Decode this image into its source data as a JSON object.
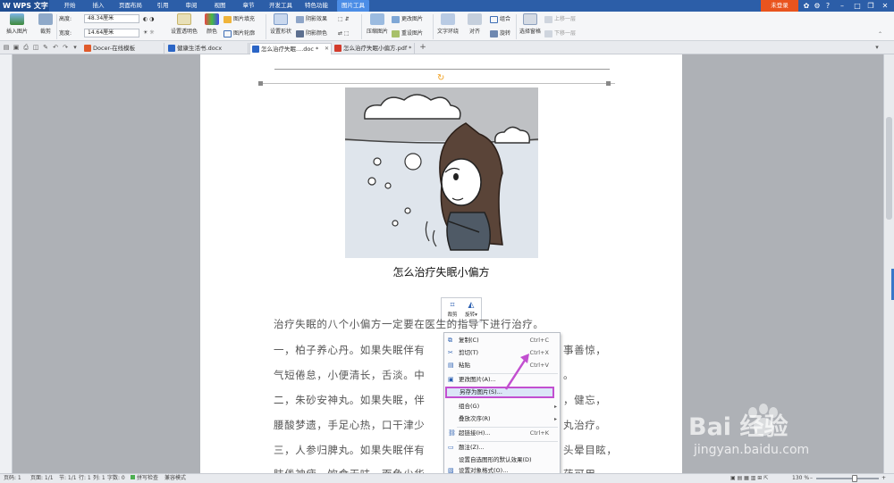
{
  "app": {
    "title": "WPS 文字",
    "login": "未登录"
  },
  "menu": [
    {
      "label": "开始"
    },
    {
      "label": "插入"
    },
    {
      "label": "页面布局"
    },
    {
      "label": "引用"
    },
    {
      "label": "审阅"
    },
    {
      "label": "视图"
    },
    {
      "label": "章节"
    },
    {
      "label": "开发工具"
    },
    {
      "label": "特色功能"
    },
    {
      "label": "图片工具",
      "active": true
    }
  ],
  "ribbon": {
    "insert_picture": "插入图片",
    "crop": "裁剪",
    "height_label": "高度:",
    "height_value": "48.34厘米",
    "width_label": "宽度:",
    "width_value": "14.64厘米",
    "set_transparent": "设置透明色",
    "color": "颜色",
    "picture_fill": "图片填充",
    "picture_outline": "图片轮廓",
    "set_shape": "设置形状",
    "shadow_effect": "阴影效果",
    "shadow_color": "阴影颜色",
    "compress": "压缩图片",
    "change_picture": "更改图片",
    "reset_picture": "重设图片",
    "text_wrap": "文字环绕",
    "align": "对齐",
    "group": "组合",
    "rotate": "旋转",
    "selection_pane": "选择窗格",
    "bring_forward": "上移一层",
    "send_backward": "下移一层"
  },
  "tabs": [
    {
      "label": "Docer-在线模板",
      "icon": "docer-icon",
      "color": "#e05a2b"
    },
    {
      "label": "健康生活书.docx",
      "icon": "word-doc-icon",
      "color": "#2b65c6"
    },
    {
      "label": "怎么治疗失眠....doc *",
      "icon": "word-doc-icon",
      "color": "#2b65c6",
      "active": true
    },
    {
      "label": "怎么治疗失眠小偏方.pdf *",
      "icon": "pdf-icon",
      "color": "#d33b2c"
    }
  ],
  "document": {
    "title": "怎么治疗失眠小偏方",
    "paragraphs": [
      "治疗失眠的八个小偏方一定要在医生的指导下进行治疗。",
      "一，柏子养心丹。如果失眠伴有",
      "气短倦怠，小便清长，舌淡。中",
      "二，朱砂安神丸。如果失眠，伴",
      "腰酸梦遗，手足心热，口干津少",
      "三，人参归脾丸。如果失眠伴有",
      "肢倦神疲，饮食无味，面色少华"
    ],
    "para_tails": [
      "事善惊，",
      "。",
      "，健忘，",
      "丸治疗。",
      "头晕目眩，",
      "药可用。"
    ]
  },
  "pic_tools": {
    "crop": "裁剪",
    "rotate": "旋转"
  },
  "context_menu": [
    {
      "label": "复制(C)",
      "shortcut": "Ctrl+C",
      "icon": "copy-icon"
    },
    {
      "label": "剪切(T)",
      "shortcut": "Ctrl+X",
      "icon": "cut-icon"
    },
    {
      "label": "粘贴",
      "shortcut": "Ctrl+V",
      "icon": "paste-icon"
    },
    {
      "label": "更改图片(A)...",
      "shortcut": "",
      "icon": "change-picture-icon"
    },
    {
      "label": "另存为图片(S)...",
      "shortcut": "",
      "icon": "",
      "highlighted": true
    },
    {
      "label": "组合(G)",
      "shortcut": "",
      "icon": "",
      "submenu": true
    },
    {
      "label": "叠放次序(R)",
      "shortcut": "",
      "icon": "",
      "submenu": true
    },
    {
      "label": "超链接(H)...",
      "shortcut": "Ctrl+K",
      "icon": "hyperlink-icon"
    },
    {
      "label": "题注(Z)...",
      "shortcut": "",
      "icon": "caption-icon"
    },
    {
      "label": "设置自选图形的默认效果(D)",
      "shortcut": "",
      "icon": ""
    },
    {
      "label": "设置对象格式(O)...",
      "shortcut": "",
      "icon": "format-icon"
    }
  ],
  "status": {
    "page": "页码: 1",
    "pages": "页面: 1/1",
    "section": "节: 1/1",
    "row": "行: 1",
    "col": "列: 1",
    "words": "字数: 0",
    "spell": "拼写检查",
    "compat": "兼容模式",
    "zoom": "130 %"
  },
  "watermark": {
    "brand": "Bai  经验",
    "url": "jingyan.baidu.com"
  },
  "colors": {
    "menubar": "#2c5ea8",
    "active_tab": "#4b8de6",
    "login": "#e9541e",
    "highlight_border": "#c24fd0",
    "arrow": "#c24fd0"
  }
}
